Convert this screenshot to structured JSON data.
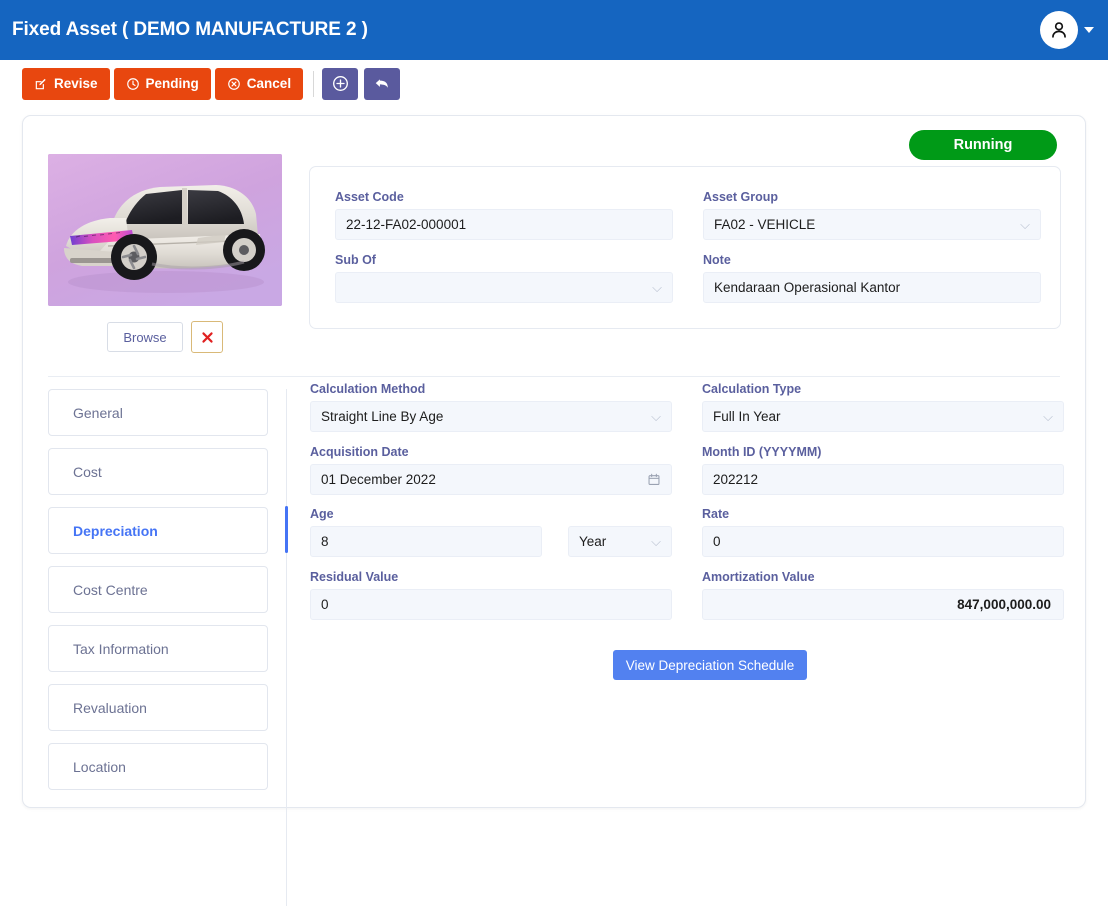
{
  "header": {
    "title": "Fixed Asset ( DEMO MANUFACTURE 2 )",
    "avatar_icon": "user-icon",
    "caret_icon": "chevron-down-icon",
    "bg_color": "#1565C0"
  },
  "toolbar": {
    "buttons": [
      {
        "label": "Revise",
        "icon": "edit-square-icon",
        "color": "#E8470F"
      },
      {
        "label": "Pending",
        "icon": "clock-icon",
        "color": "#E8470F"
      },
      {
        "label": "Cancel",
        "icon": "cancel-circle-icon",
        "color": "#E8470F"
      }
    ],
    "icon_buttons": [
      {
        "name": "add-button",
        "icon": "plus-circle-icon",
        "color": "#5A5A9E"
      },
      {
        "name": "back-button",
        "icon": "undo-arrow-icon",
        "color": "#5A5A9E"
      }
    ]
  },
  "status": {
    "label": "Running",
    "color": "#009A17"
  },
  "photo": {
    "alt": "asset-vehicle-photo",
    "browse_label": "Browse",
    "remove_icon": "red-x-icon"
  },
  "info_panel": {
    "asset_code": {
      "label": "Asset Code",
      "value": "22-12-FA02-000001",
      "type": "text"
    },
    "asset_group": {
      "label": "Asset Group",
      "value": "FA02 - VEHICLE",
      "type": "select"
    },
    "sub_of": {
      "label": "Sub Of",
      "value": "",
      "type": "select"
    },
    "note": {
      "label": "Note",
      "value": "Kendaraan Operasional Kantor",
      "type": "text"
    }
  },
  "tabs": {
    "active": "Depreciation",
    "items": [
      {
        "label": "General",
        "active": false
      },
      {
        "label": "Cost",
        "active": false
      },
      {
        "label": "Depreciation",
        "active": true
      },
      {
        "label": "Cost Centre",
        "active": false
      },
      {
        "label": "Tax Information",
        "active": false
      },
      {
        "label": "Revaluation",
        "active": false
      },
      {
        "label": "Location",
        "active": false
      }
    ],
    "active_color": "#4574F5"
  },
  "depreciation": {
    "calculation_method": {
      "label": "Calculation Method",
      "value": "Straight Line By Age",
      "type": "select"
    },
    "calculation_type": {
      "label": "Calculation Type",
      "value": "Full In Year",
      "type": "select"
    },
    "acquisition_date": {
      "label": "Acquisition Date",
      "value": "01 December 2022",
      "type": "date",
      "icon": "calendar-icon"
    },
    "month_id": {
      "label": "Month ID (YYYYMM)",
      "value": "202212",
      "type": "text"
    },
    "age": {
      "label": "Age",
      "value": "8",
      "unit": "Year",
      "type": "number"
    },
    "rate": {
      "label": "Rate",
      "value": "0",
      "type": "number"
    },
    "residual_value": {
      "label": "Residual Value",
      "value": "0",
      "type": "number"
    },
    "amortization_value": {
      "label": "Amortization Value",
      "value": "847,000,000.00",
      "type": "number"
    },
    "view_schedule_button": "View Depreciation Schedule"
  }
}
